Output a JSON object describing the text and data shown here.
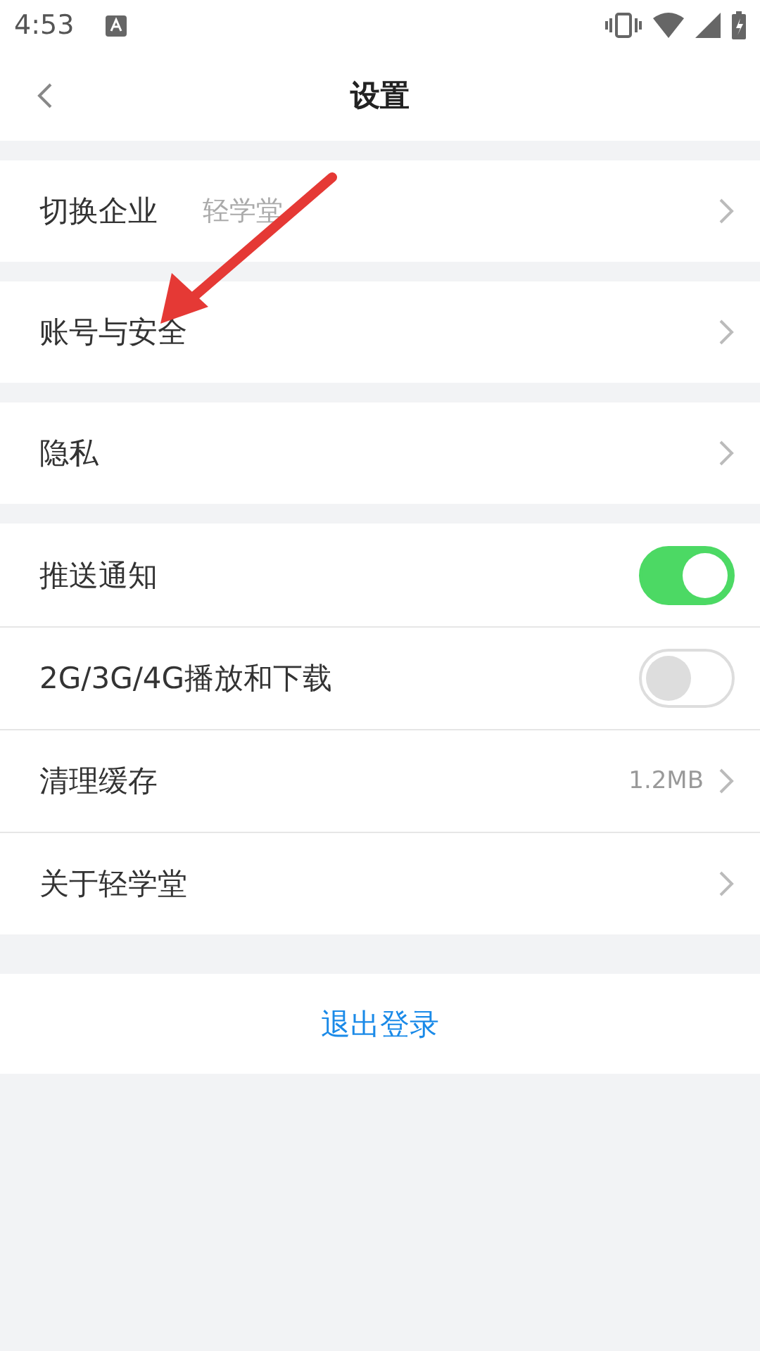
{
  "status_bar": {
    "time": "4:53"
  },
  "header": {
    "title": "设置"
  },
  "groups": [
    {
      "rows": [
        {
          "kind": "link",
          "label": "切换企业",
          "value": "轻学堂"
        }
      ]
    },
    {
      "rows": [
        {
          "kind": "link",
          "label": "账号与安全"
        }
      ]
    },
    {
      "rows": [
        {
          "kind": "link",
          "label": "隐私"
        }
      ]
    },
    {
      "rows": [
        {
          "kind": "toggle",
          "label": "推送通知",
          "on": true
        },
        {
          "kind": "toggle",
          "label": "2G/3G/4G播放和下载",
          "on": false
        },
        {
          "kind": "detail",
          "label": "清理缓存",
          "value": "1.2MB"
        },
        {
          "kind": "link",
          "label": "关于轻学堂"
        }
      ]
    }
  ],
  "logout": {
    "label": "退出登录"
  }
}
